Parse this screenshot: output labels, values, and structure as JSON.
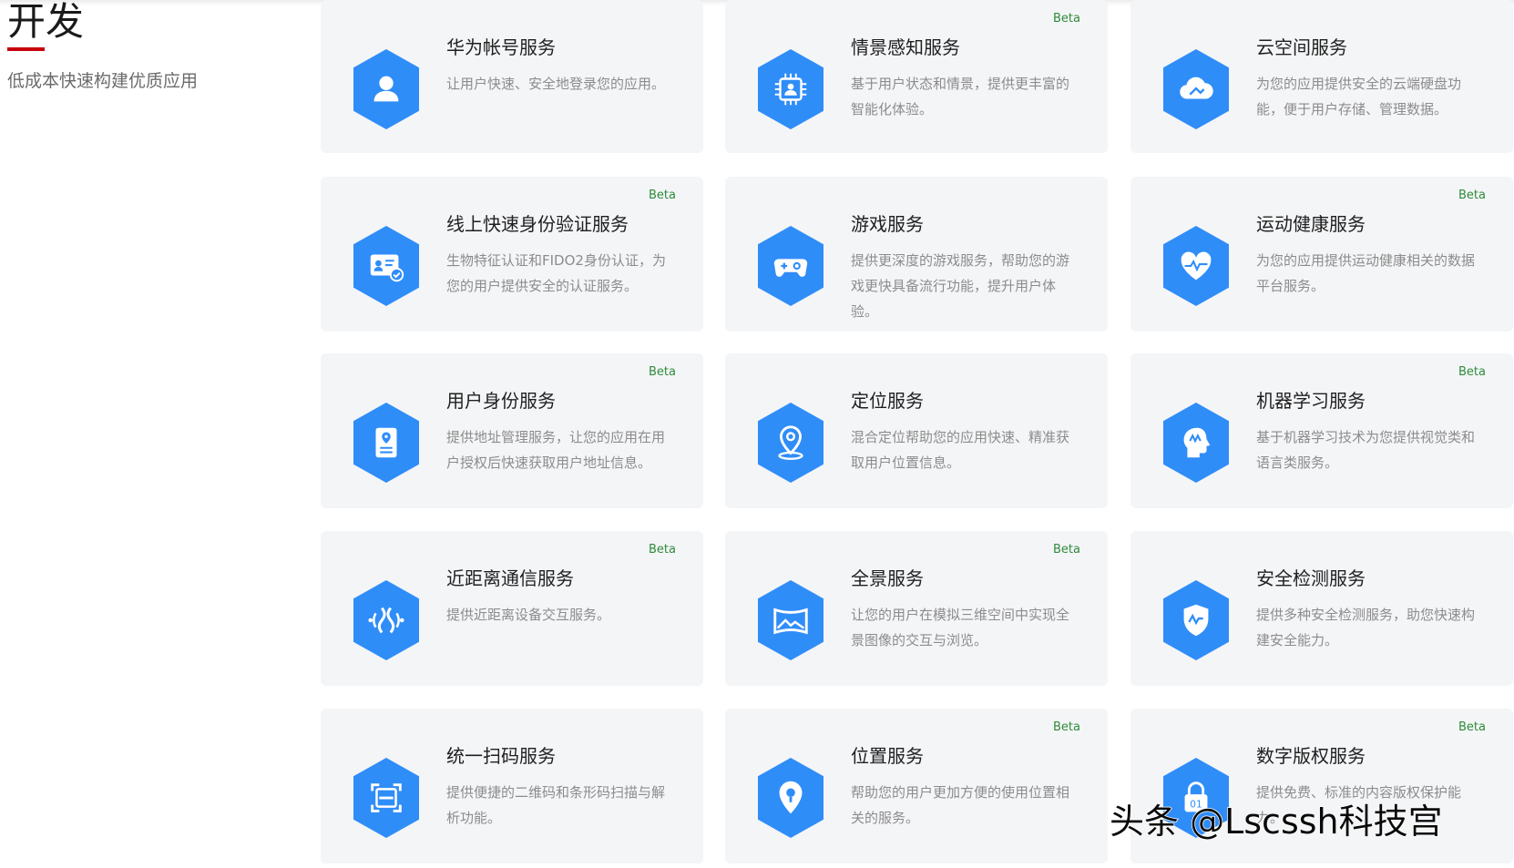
{
  "section": {
    "title": "开发",
    "subtitle": "低成本快速构建优质应用"
  },
  "cards": [
    {
      "title": "华为帐号服务",
      "desc": "让用户快速、安全地登录您的应用。",
      "badge": "",
      "icon": "user-icon"
    },
    {
      "title": "情景感知服务",
      "desc": "基于用户状态和情景，提供更丰富的智能化体验。",
      "badge": "Beta",
      "icon": "chip-user-icon"
    },
    {
      "title": "云空间服务",
      "desc": "为您的应用提供安全的云端硬盘功能，便于用户存储、管理数据。",
      "badge": "",
      "icon": "cloud-icon"
    },
    {
      "title": "线上快速身份验证服务",
      "desc": "生物特征认证和FIDO2身份认证，为您的用户提供安全的认证服务。",
      "badge": "Beta",
      "icon": "id-card-check-icon"
    },
    {
      "title": "游戏服务",
      "desc": "提供更深度的游戏服务，帮助您的游戏更快具备流行功能，提升用户体验。",
      "badge": "",
      "icon": "gamepad-icon"
    },
    {
      "title": "运动健康服务",
      "desc": "为您的应用提供运动健康相关的数据平台服务。",
      "badge": "Beta",
      "icon": "heart-pulse-icon"
    },
    {
      "title": "用户身份服务",
      "desc": "提供地址管理服务，让您的应用在用户授权后快速获取用户地址信息。",
      "badge": "Beta",
      "icon": "address-doc-icon"
    },
    {
      "title": "定位服务",
      "desc": "混合定位帮助您的应用快速、精准获取用户位置信息。",
      "badge": "",
      "icon": "location-pin-icon"
    },
    {
      "title": "机器学习服务",
      "desc": "基于机器学习技术为您提供视觉类和语言类服务。",
      "badge": "Beta",
      "icon": "ai-head-icon"
    },
    {
      "title": "近距离通信服务",
      "desc": "提供近距离设备交互服务。",
      "badge": "Beta",
      "icon": "nearby-signal-icon"
    },
    {
      "title": "全景服务",
      "desc": "让您的用户在模拟三维空间中实现全景图像的交互与浏览。",
      "badge": "Beta",
      "icon": "panorama-icon"
    },
    {
      "title": "安全检测服务",
      "desc": "提供多种安全检测服务，助您快速构建安全能力。",
      "badge": "",
      "icon": "shield-pulse-icon"
    },
    {
      "title": "统一扫码服务",
      "desc": "提供便捷的二维码和条形码扫描与解析功能。",
      "badge": "",
      "icon": "scan-icon"
    },
    {
      "title": "位置服务",
      "desc": "帮助您的用户更加方便的使用位置相关的服务。",
      "badge": "Beta",
      "icon": "map-pin-icon"
    },
    {
      "title": "数字版权服务",
      "desc": "提供免费、标准的内容版权保护能力。",
      "badge": "Beta",
      "icon": "drm-lock-icon"
    }
  ],
  "watermark": "头条 @Lscssh科技宫",
  "colors": {
    "accent_blue": "#2f8df8",
    "title_underline": "#c7000b",
    "beta_green": "#2e8b3a",
    "card_bg": "#f4f5f7"
  }
}
